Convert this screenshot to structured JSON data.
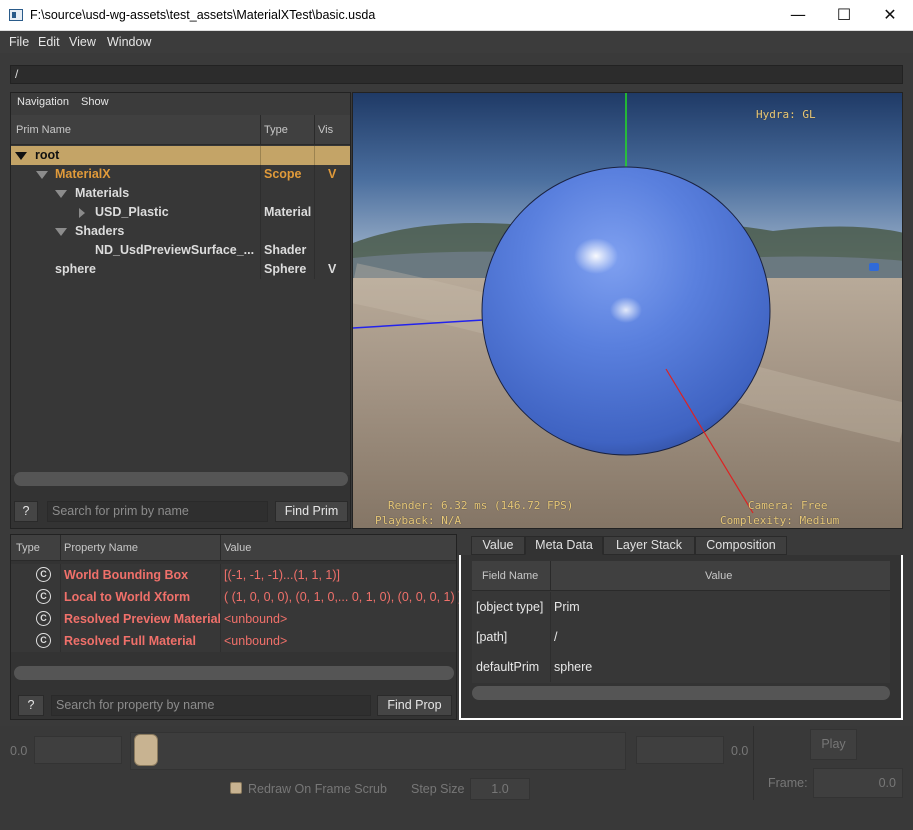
{
  "window": {
    "title": "F:\\source\\usd-wg-assets\\test_assets\\MaterialXTest\\basic.usda",
    "minimize": "—",
    "maximize": "☐",
    "close": "✕"
  },
  "menu": {
    "file": "File",
    "edit": "Edit",
    "view": "View",
    "window": "Window"
  },
  "path": "/",
  "browser": {
    "tabs": {
      "navigation": "Navigation",
      "show": "Show"
    },
    "columns": {
      "name": "Prim Name",
      "type": "Type",
      "vis": "Vis"
    },
    "rows": [
      {
        "name": "root",
        "type": "",
        "vis": ""
      },
      {
        "name": "MaterialX",
        "type": "Scope",
        "vis": "V"
      },
      {
        "name": "Materials",
        "type": "",
        "vis": ""
      },
      {
        "name": "USD_Plastic",
        "type": "Material",
        "vis": ""
      },
      {
        "name": "Shaders",
        "type": "",
        "vis": ""
      },
      {
        "name": "ND_UsdPreviewSurface_...",
        "type": "Shader",
        "vis": ""
      },
      {
        "name": "sphere",
        "type": "Sphere",
        "vis": "V"
      }
    ],
    "help_label": "?",
    "search_placeholder": "Search for prim by name",
    "find_label": "Find Prim"
  },
  "viewport": {
    "renderer": "Hydra: GL",
    "render_stats": "Render: 6.32 ms (146.72 FPS)",
    "playback": "Playback: N/A",
    "camera": "Camera: Free",
    "complexity": "Complexity: Medium"
  },
  "properties": {
    "columns": {
      "type": "Type",
      "name": "Property Name",
      "value": "Value"
    },
    "icon_glyph": "C",
    "rows": [
      {
        "name": "World Bounding Box",
        "value": "[(-1, -1, -1)...(1, 1, 1)]"
      },
      {
        "name": "Local to World Xform",
        "value": "( (1, 0, 0, 0), (0, 1, 0,... 0, 1, 0), (0, 0, 0, 1) )"
      },
      {
        "name": "Resolved Preview Material",
        "value": "<unbound>"
      },
      {
        "name": "Resolved Full Material",
        "value": "<unbound>"
      }
    ],
    "help_label": "?",
    "search_placeholder": "Search for property by name",
    "find_label": "Find Prop"
  },
  "metadata": {
    "tabs": [
      "Value",
      "Meta Data",
      "Layer Stack",
      "Composition"
    ],
    "columns": {
      "field": "Field Name",
      "value": "Value"
    },
    "rows": [
      {
        "field": "[object type]",
        "value": "Prim"
      },
      {
        "field": "[path]",
        "value": "/"
      },
      {
        "field": "defaultPrim",
        "value": "sphere"
      }
    ]
  },
  "timeline": {
    "start_value": "0.0",
    "end_value": "0.0",
    "play_label": "Play",
    "redraw_label": "Redraw On Frame Scrub",
    "step_label": "Step Size",
    "step_value": "1.0",
    "frame_label": "Frame:",
    "frame_value": "0.0"
  },
  "colors": {
    "accent_orange": "#e09a3a",
    "selection": "#c4a467",
    "property_red": "#f0706a",
    "hud_yellow": "#e8c878",
    "sphere_blue": "#4e76d8"
  }
}
